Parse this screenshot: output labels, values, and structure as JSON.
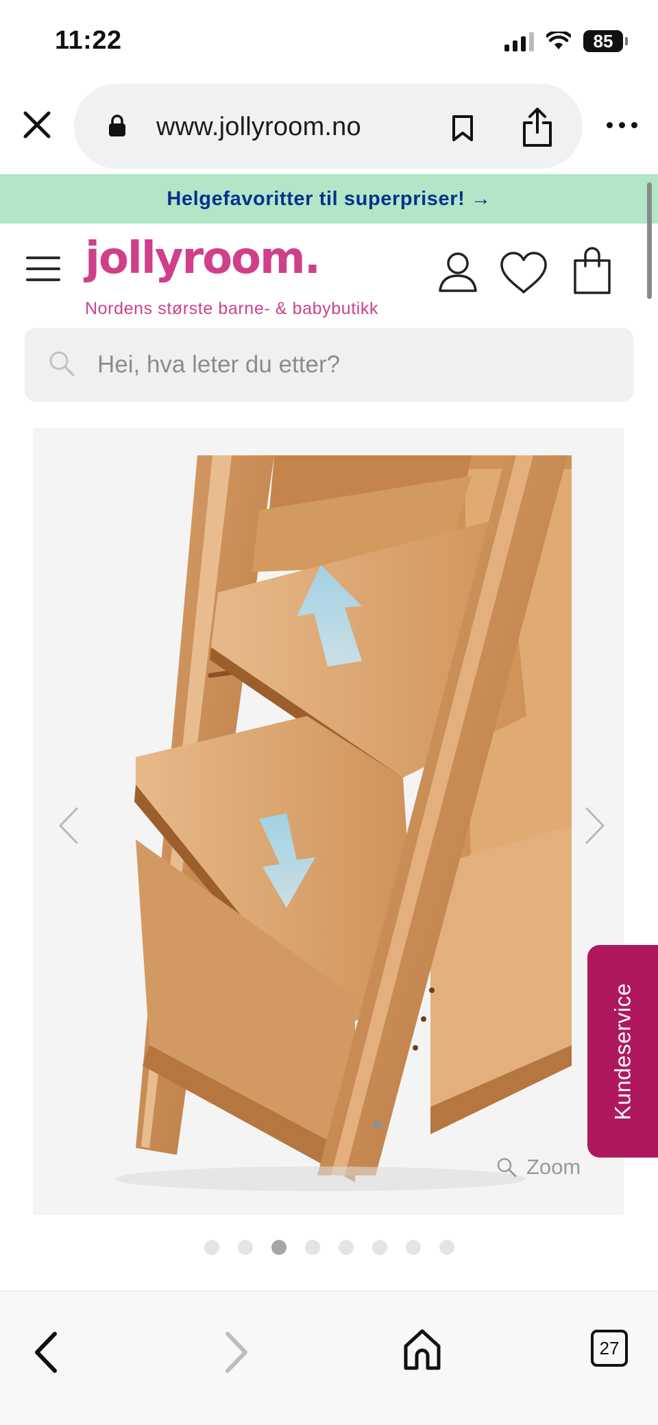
{
  "status_bar": {
    "time": "11:22",
    "battery": "85"
  },
  "browser": {
    "url": "www.jollyroom.no",
    "tab_count": "27"
  },
  "promo": {
    "text": "Helgefavoritter til superpriser! →"
  },
  "header": {
    "logo": "jollyroom.",
    "tagline": "Nordens største barne- & babybutikk"
  },
  "search": {
    "placeholder": "Hei, hva leter du etter?"
  },
  "gallery": {
    "zoom_label": "Zoom",
    "image_count": 8,
    "active_image": 3
  },
  "service_tab": {
    "label": "Kundeservice"
  },
  "icons": {
    "close": "close-icon",
    "lock": "lock-icon",
    "bookmark": "bookmark-icon",
    "share": "share-icon",
    "more": "more-icon",
    "menu": "menu-icon",
    "account": "user-icon",
    "wishlist": "heart-icon",
    "cart": "shopping-bag-icon",
    "search": "search-icon",
    "prev": "chevron-left-icon",
    "next": "chevron-right-icon",
    "zoom": "zoom-icon",
    "home": "home-icon",
    "back": "back-icon",
    "forward": "forward-icon"
  },
  "colors": {
    "brand": "#cf3f8a",
    "promo_bg": "#b1e6c6",
    "promo_text": "#0b2f8f",
    "service_tab": "#b0185e"
  }
}
